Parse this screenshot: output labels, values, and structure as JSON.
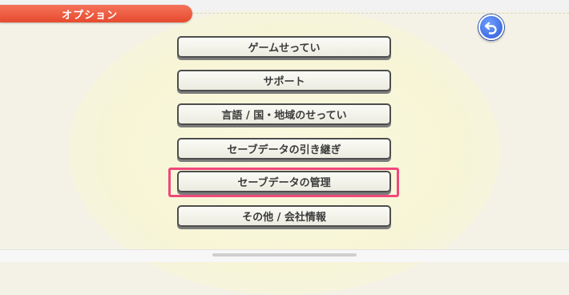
{
  "header": {
    "title": "オプション"
  },
  "back_button": {
    "icon": "back-arrow-icon",
    "color": "#2d59d8"
  },
  "menu": {
    "items": [
      {
        "label": "ゲームせってい"
      },
      {
        "label": "サポート"
      },
      {
        "label": "言語 / 国・地域のせってい"
      },
      {
        "label": "セーブデータの引き継ぎ"
      },
      {
        "label": "セーブデータの管理",
        "selected": true
      },
      {
        "label": "その他 / 会社情報"
      }
    ]
  },
  "colors": {
    "header_tab": "#e64a2e",
    "selection_highlight": "#f0487b",
    "button_text": "#3b3b3b"
  }
}
